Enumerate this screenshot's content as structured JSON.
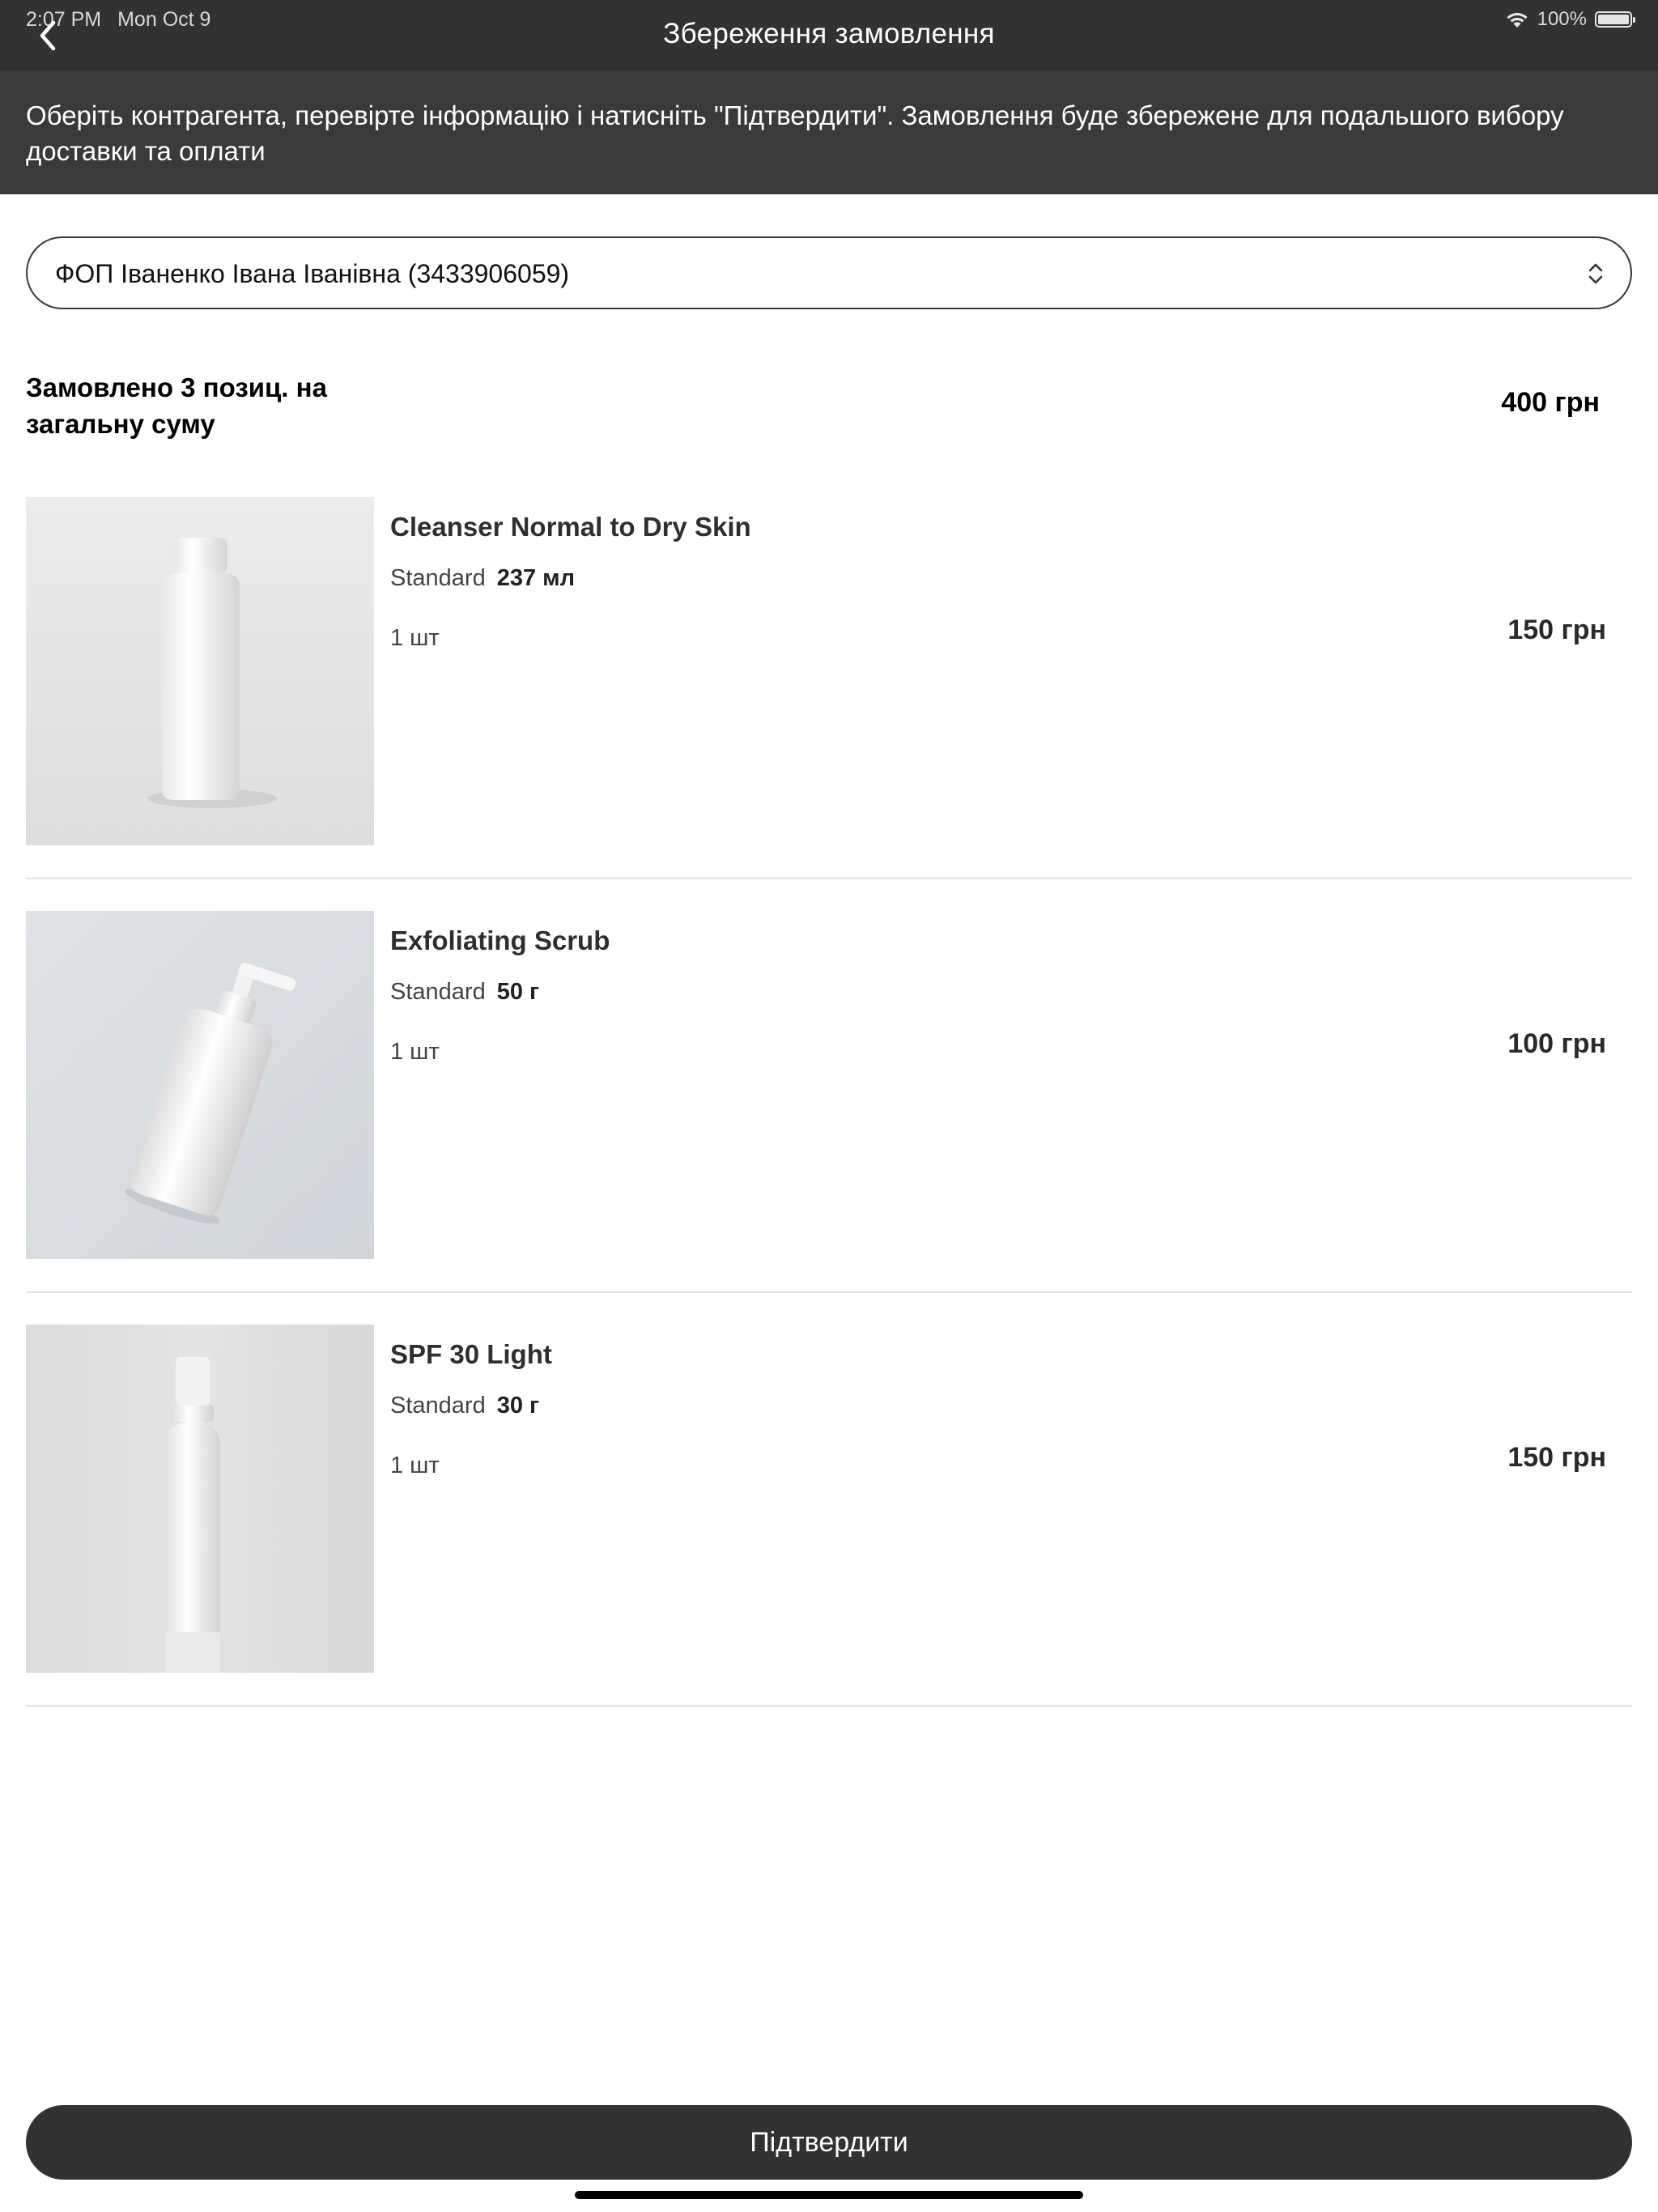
{
  "status_bar": {
    "time": "2:07 PM",
    "date": "Mon Oct 9",
    "battery": "100%"
  },
  "header": {
    "title": "Збереження замовлення",
    "back_icon": "chevron-left-icon"
  },
  "banner": {
    "text": "Оберіть контрагента, перевірте інформацію і натисніть \"Підтвердити\". Замовлення буде збережене для подальшого вибору доставки та оплати"
  },
  "counterparty": {
    "selected": "ФОП Іваненко Івана Іванівна (3433906059)",
    "icon": "chevron-up-down-icon"
  },
  "summary": {
    "label": "Замовлено 3 позиц. на загальну суму",
    "total": "400 грн"
  },
  "items": [
    {
      "name": "Cleanser Normal to Dry Skin",
      "variant_label": "Standard",
      "variant_value": "237 мл",
      "quantity": "1 шт",
      "price": "150 грн",
      "image": "bottle-image"
    },
    {
      "name": "Exfoliating Scrub",
      "variant_label": "Standard",
      "variant_value": "50 г",
      "quantity": "1 шт",
      "price": "100 грн",
      "image": "pump-bottle-image"
    },
    {
      "name": "SPF 30 Light",
      "variant_label": "Standard",
      "variant_value": "30 г",
      "quantity": "1 шт",
      "price": "150 грн",
      "image": "spray-bottle-image"
    }
  ],
  "footer": {
    "confirm_label": "Підтвердити"
  },
  "colors": {
    "header_bg": "#323232",
    "banner_bg": "#3a3a3a",
    "button_bg": "#323232",
    "divider": "#e3e3e3"
  }
}
